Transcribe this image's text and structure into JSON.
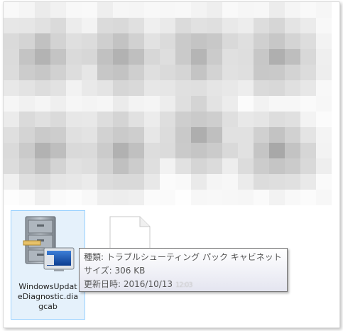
{
  "files": [
    {
      "name": "WindowsUpdateDiagnostic.diagcab",
      "name_lines": [
        "WindowsUpdat",
        "eDiagnostic.dia",
        "gcab"
      ],
      "icon": "file-cabinet-icon",
      "selected": true
    },
    {
      "name": "",
      "icon": "blank-document-icon",
      "selected": false
    }
  ],
  "tooltip": {
    "type_line": "種類: トラブルシューティング パック キャビネット",
    "size_line": "サイズ: 306 KB",
    "date_line": "更新日時: 2016/10/13 ",
    "date_time_blurred": "12:03"
  },
  "colors": {
    "selection_bg": "#e5f1fb",
    "selection_border": "#99d1ff",
    "tooltip_border": "#767676",
    "tooltip_text": "#575757"
  }
}
